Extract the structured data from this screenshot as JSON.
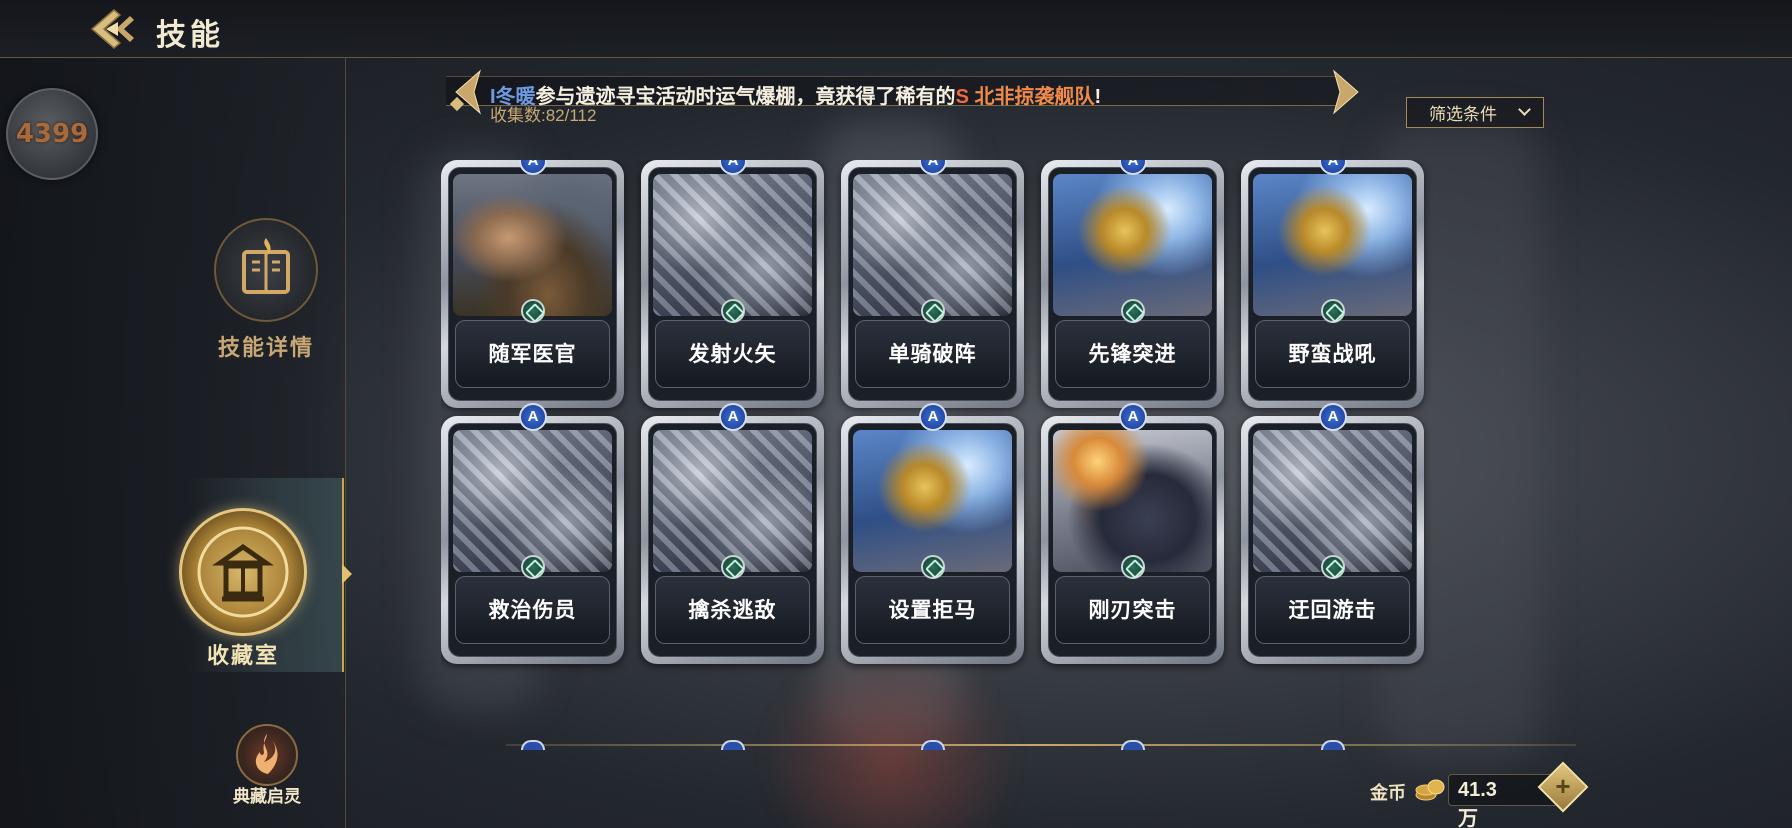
{
  "header": {
    "title": "技能"
  },
  "sidebar": {
    "logo_text": "4399",
    "items": [
      {
        "label": "技能详情"
      },
      {
        "label": "收藏室"
      },
      {
        "label": "典藏启灵"
      }
    ]
  },
  "banner": {
    "player_name": "I冬暖",
    "middle_text": "参与遗迹寻宝活动时运气爆棚，竟获得了稀有的",
    "grade": "S",
    "item_name": " 北非掠袭舰队",
    "suffix": "!"
  },
  "collection": {
    "count_text": "收集数:82/112"
  },
  "filter": {
    "label": "筛选条件"
  },
  "cards": [
    {
      "name": "随军医官",
      "grade": "A",
      "art": "medic"
    },
    {
      "name": "发射火矢",
      "grade": "A",
      "art": "axes"
    },
    {
      "name": "单骑破阵",
      "grade": "A",
      "art": "axes"
    },
    {
      "name": "先锋突进",
      "grade": "A",
      "art": "eagle"
    },
    {
      "name": "野蛮战吼",
      "grade": "A",
      "art": "eagle"
    },
    {
      "name": "救治伤员",
      "grade": "A",
      "art": "axes"
    },
    {
      "name": "擒杀逃敌",
      "grade": "A",
      "art": "axes"
    },
    {
      "name": "设置拒马",
      "grade": "A",
      "art": "eagle"
    },
    {
      "name": "刚刃突击",
      "grade": "A",
      "art": "chariot"
    },
    {
      "name": "迂回游击",
      "grade": "A",
      "art": "axes"
    }
  ],
  "currency": {
    "label": "金币",
    "value": "41.3万",
    "add_label": "+"
  },
  "colors": {
    "gold_accent": "#c9a76a",
    "banner_name": "#6e9ae2",
    "banner_item": "#f08a4a",
    "grade_badge": "#2a4fa8"
  },
  "icons": {
    "back": "back-arrow-icon",
    "coin": "coin-stack-icon",
    "filter": "chevron-down-icon"
  }
}
